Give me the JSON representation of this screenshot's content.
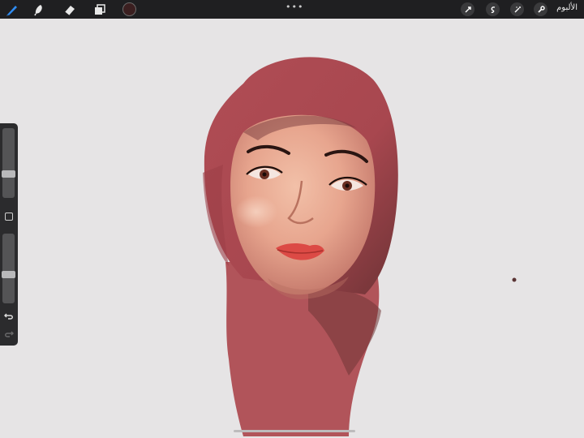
{
  "toolbar": {
    "gallery_label": "الألبوم",
    "more_dots": "•••",
    "tools": [
      "brush-icon",
      "smudge-icon",
      "eraser-icon",
      "layers-icon",
      "color-icon"
    ],
    "actions": [
      "wrench-icon",
      "magic-wand-icon",
      "selection-icon",
      "transform-icon"
    ],
    "current_color": "#3b1f20"
  },
  "sidebar": {
    "brush_size_level": 0.33,
    "opacity_level": 0.4
  },
  "canvas": {
    "background": "#e6e4e5",
    "hijab_color": "#b1545a",
    "skin_color": "#e7a58e"
  }
}
